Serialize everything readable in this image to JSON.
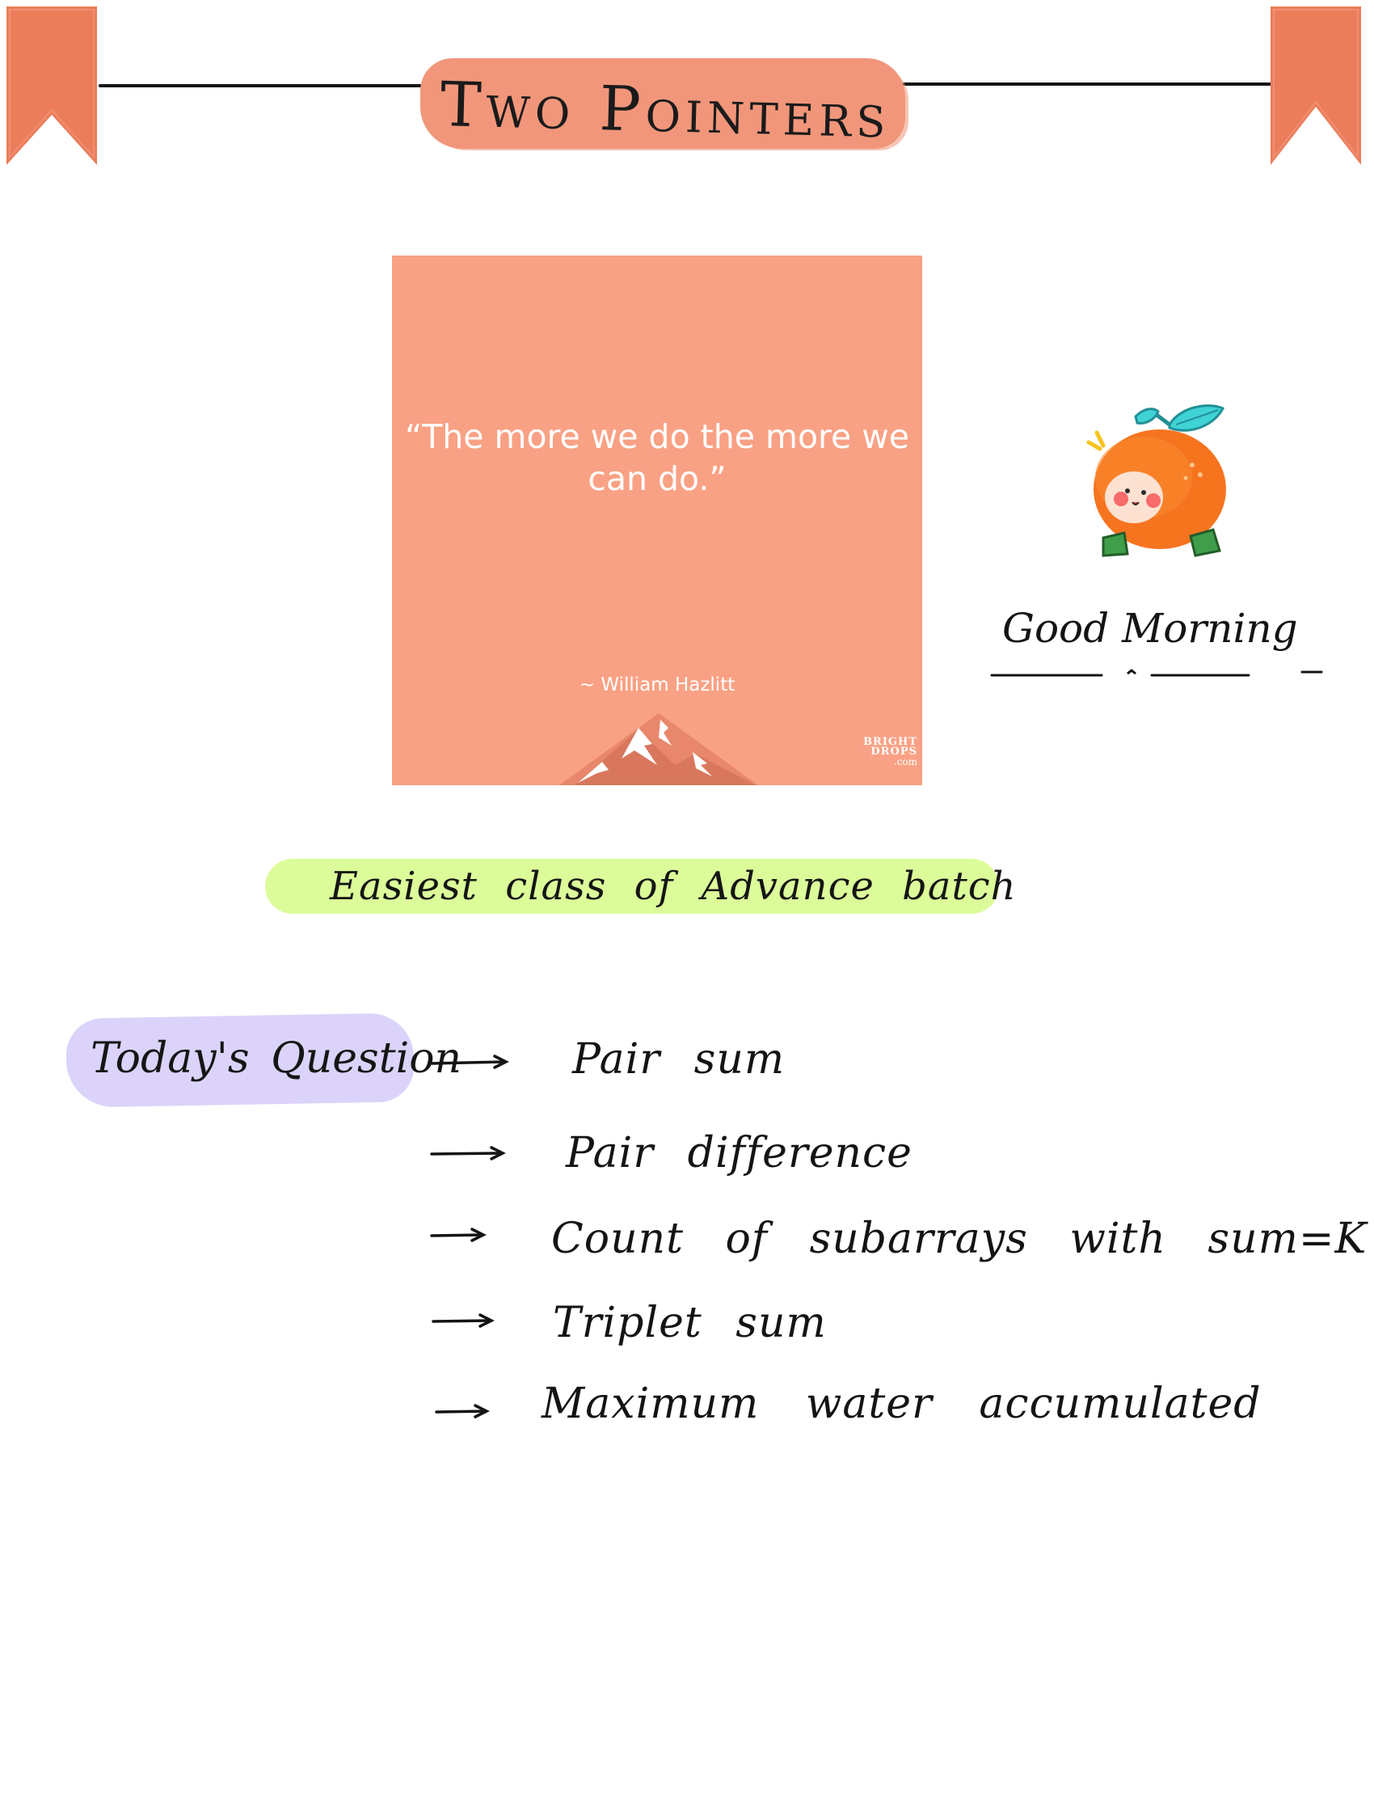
{
  "header": {
    "title": "Two Pointers"
  },
  "quote_card": {
    "quote": "“The more we do the more we can do.”",
    "author": "~ William Hazlitt",
    "brand": {
      "line1": "BRIGHT",
      "line2": "DROPS",
      "line3": ".com"
    }
  },
  "greeting": {
    "text": "Good Morning"
  },
  "banner": {
    "text": "Easiest class of Advance batch"
  },
  "questions": {
    "label": "Today's Question",
    "items": [
      "Pair sum",
      "Pair difference",
      "Count of subarrays with sum=K",
      "Triplet sum",
      "Maximum water accumulated"
    ]
  },
  "colors": {
    "title_pill": "#f1967a",
    "flag": "#ec7d5a",
    "quote_card": "#f9a184",
    "banner_pill": "#dcfc9a",
    "question_pill": "#dcd3fb",
    "ink": "#141414"
  },
  "icons": [
    "bookmark-flag-icon",
    "mountain-icon",
    "orange-character-icon",
    "right-arrow-icon"
  ]
}
